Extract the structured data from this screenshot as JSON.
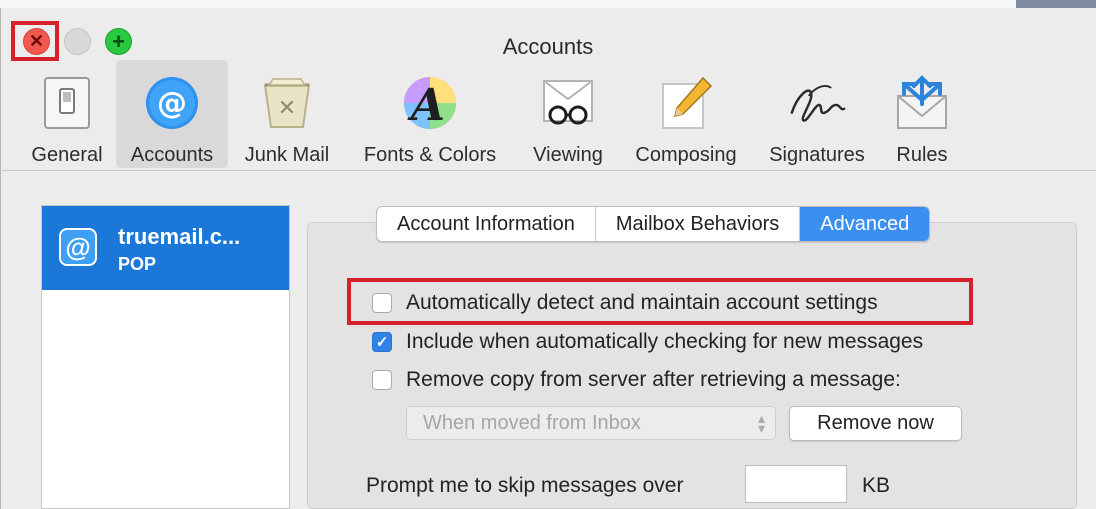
{
  "window": {
    "title": "Accounts",
    "traffic": {
      "close_glyph": "✕",
      "zoom_glyph": "+"
    }
  },
  "toolbar": {
    "items": [
      {
        "label": "General",
        "icon": "switch-icon"
      },
      {
        "label": "Accounts",
        "icon": "at-sign-icon"
      },
      {
        "label": "Junk Mail",
        "icon": "trash-bin-icon"
      },
      {
        "label": "Fonts & Colors",
        "icon": "font-color-icon"
      },
      {
        "label": "Viewing",
        "icon": "glasses-icon"
      },
      {
        "label": "Composing",
        "icon": "pencil-paper-icon"
      },
      {
        "label": "Signatures",
        "icon": "signature-icon"
      },
      {
        "label": "Rules",
        "icon": "rules-envelope-icon"
      }
    ],
    "selected": "Accounts"
  },
  "accounts": [
    {
      "name": "truemail.c...",
      "type": "POP",
      "icon_glyph": "@"
    }
  ],
  "tabs": {
    "items": [
      "Account Information",
      "Mailbox Behaviors",
      "Advanced"
    ],
    "selected": "Advanced"
  },
  "advanced": {
    "auto_detect": {
      "label": "Automatically detect and maintain account settings",
      "checked": false
    },
    "include_checking": {
      "label": "Include when automatically checking for new messages",
      "checked": true
    },
    "remove_copy": {
      "label": "Remove copy from server after retrieving a message:",
      "checked": false
    },
    "remove_when": {
      "value": "When moved from Inbox",
      "enabled": false
    },
    "remove_now_label": "Remove now",
    "prompt_label": "Prompt me to skip messages over",
    "prompt_value": "",
    "prompt_unit": "KB"
  },
  "colors": {
    "accent": "#3b8ff0",
    "selection": "#1c78d8",
    "highlight": "#d6202b"
  }
}
